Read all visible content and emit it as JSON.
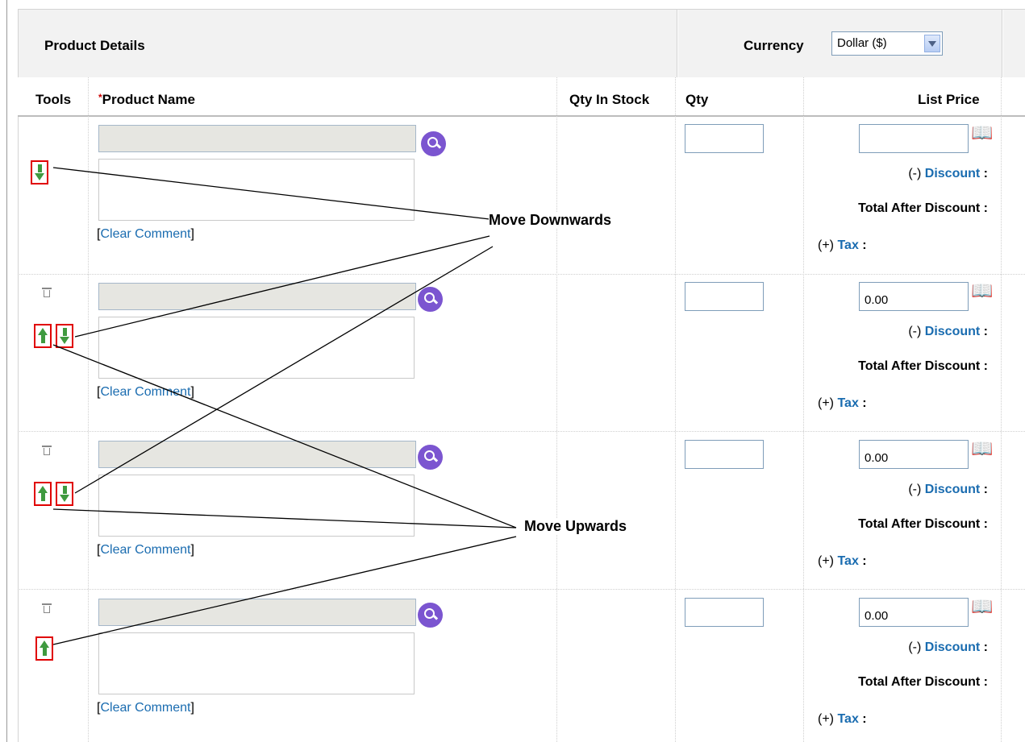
{
  "header": {
    "section_title": "Product Details",
    "currency_label": "Currency",
    "currency_value": "Dollar ($)"
  },
  "columns": {
    "tools": "Tools",
    "required_mark": "*",
    "product_name": "Product Name",
    "qty_in_stock": "Qty In Stock",
    "qty": "Qty",
    "list_price": "List Price"
  },
  "rows": [
    {
      "price_value": "",
      "clear_comment": "Clear Comment",
      "discount_prefix": "(-)",
      "discount_label": "Discount",
      "total_after_discount": "Total After Discount :",
      "tax_prefix": "(+)",
      "tax_label": "Tax"
    },
    {
      "price_value": "0.00",
      "clear_comment": "Clear Comment",
      "discount_prefix": "(-)",
      "discount_label": "Discount",
      "total_after_discount": "Total After Discount :",
      "tax_prefix": "(+)",
      "tax_label": "Tax"
    },
    {
      "price_value": "0.00",
      "clear_comment": "Clear Comment",
      "discount_prefix": "(-)",
      "discount_label": "Discount",
      "total_after_discount": "Total After Discount :",
      "tax_prefix": "(+)",
      "tax_label": "Tax"
    },
    {
      "price_value": "0.00",
      "clear_comment": "Clear Comment",
      "discount_prefix": "(-)",
      "discount_label": "Discount",
      "total_after_discount": "Total After Discount :",
      "tax_prefix": "(+)",
      "tax_label": "Tax"
    }
  ],
  "annotations": {
    "move_downwards": "Move Downwards",
    "move_upwards": "Move Upwards"
  }
}
